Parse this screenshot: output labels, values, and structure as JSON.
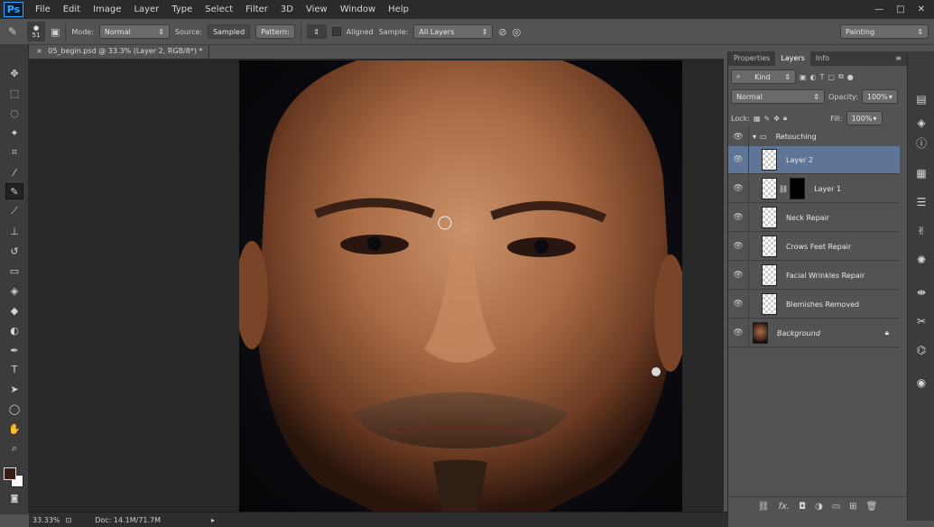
{
  "app": {
    "logo": "Ps"
  },
  "menu": [
    "File",
    "Edit",
    "Image",
    "Layer",
    "Type",
    "Select",
    "Filter",
    "3D",
    "View",
    "Window",
    "Help"
  ],
  "window_controls": {
    "minimize": "—",
    "maximize": "□",
    "close": "✕"
  },
  "options": {
    "brush_size": "51",
    "mode_label": "Mode:",
    "mode_value": "Normal",
    "source_label": "Source:",
    "sampled": "Sampled",
    "pattern": "Pattern:",
    "aligned": "Aligned",
    "sample_label": "Sample:",
    "sample_value": "All Layers",
    "workspace": "Painting"
  },
  "document": {
    "tab_title": "05_begin.psd @ 33.3% (Layer 2, RGB/8*) *",
    "tab_close": "×"
  },
  "status": {
    "zoom": "33.33%",
    "doc": "Doc: 14.1M/71.7M"
  },
  "panel": {
    "tabs": [
      "Properties",
      "Layers",
      "Info"
    ],
    "active_tab": "Layers",
    "filter_kind": "Kind",
    "blend_mode": "Normal",
    "opacity_label": "Opacity:",
    "opacity_value": "100%",
    "lock_label": "Lock:",
    "fill_label": "Fill:",
    "fill_value": "100%",
    "group_name": "Retouching",
    "layers": [
      {
        "name": "Layer 2",
        "selected": true
      },
      {
        "name": "Layer 1",
        "mask": true
      },
      {
        "name": "Neck Repair"
      },
      {
        "name": "Crows Feet Repair"
      },
      {
        "name": "Facial Wrinkles Repair"
      },
      {
        "name": "Blemishes Removed"
      },
      {
        "name": "Background",
        "italic": true,
        "locked": true
      }
    ]
  },
  "colors": {
    "foreground": "#3a1a14",
    "background": "#ffffff",
    "selection": "#5f7596"
  }
}
